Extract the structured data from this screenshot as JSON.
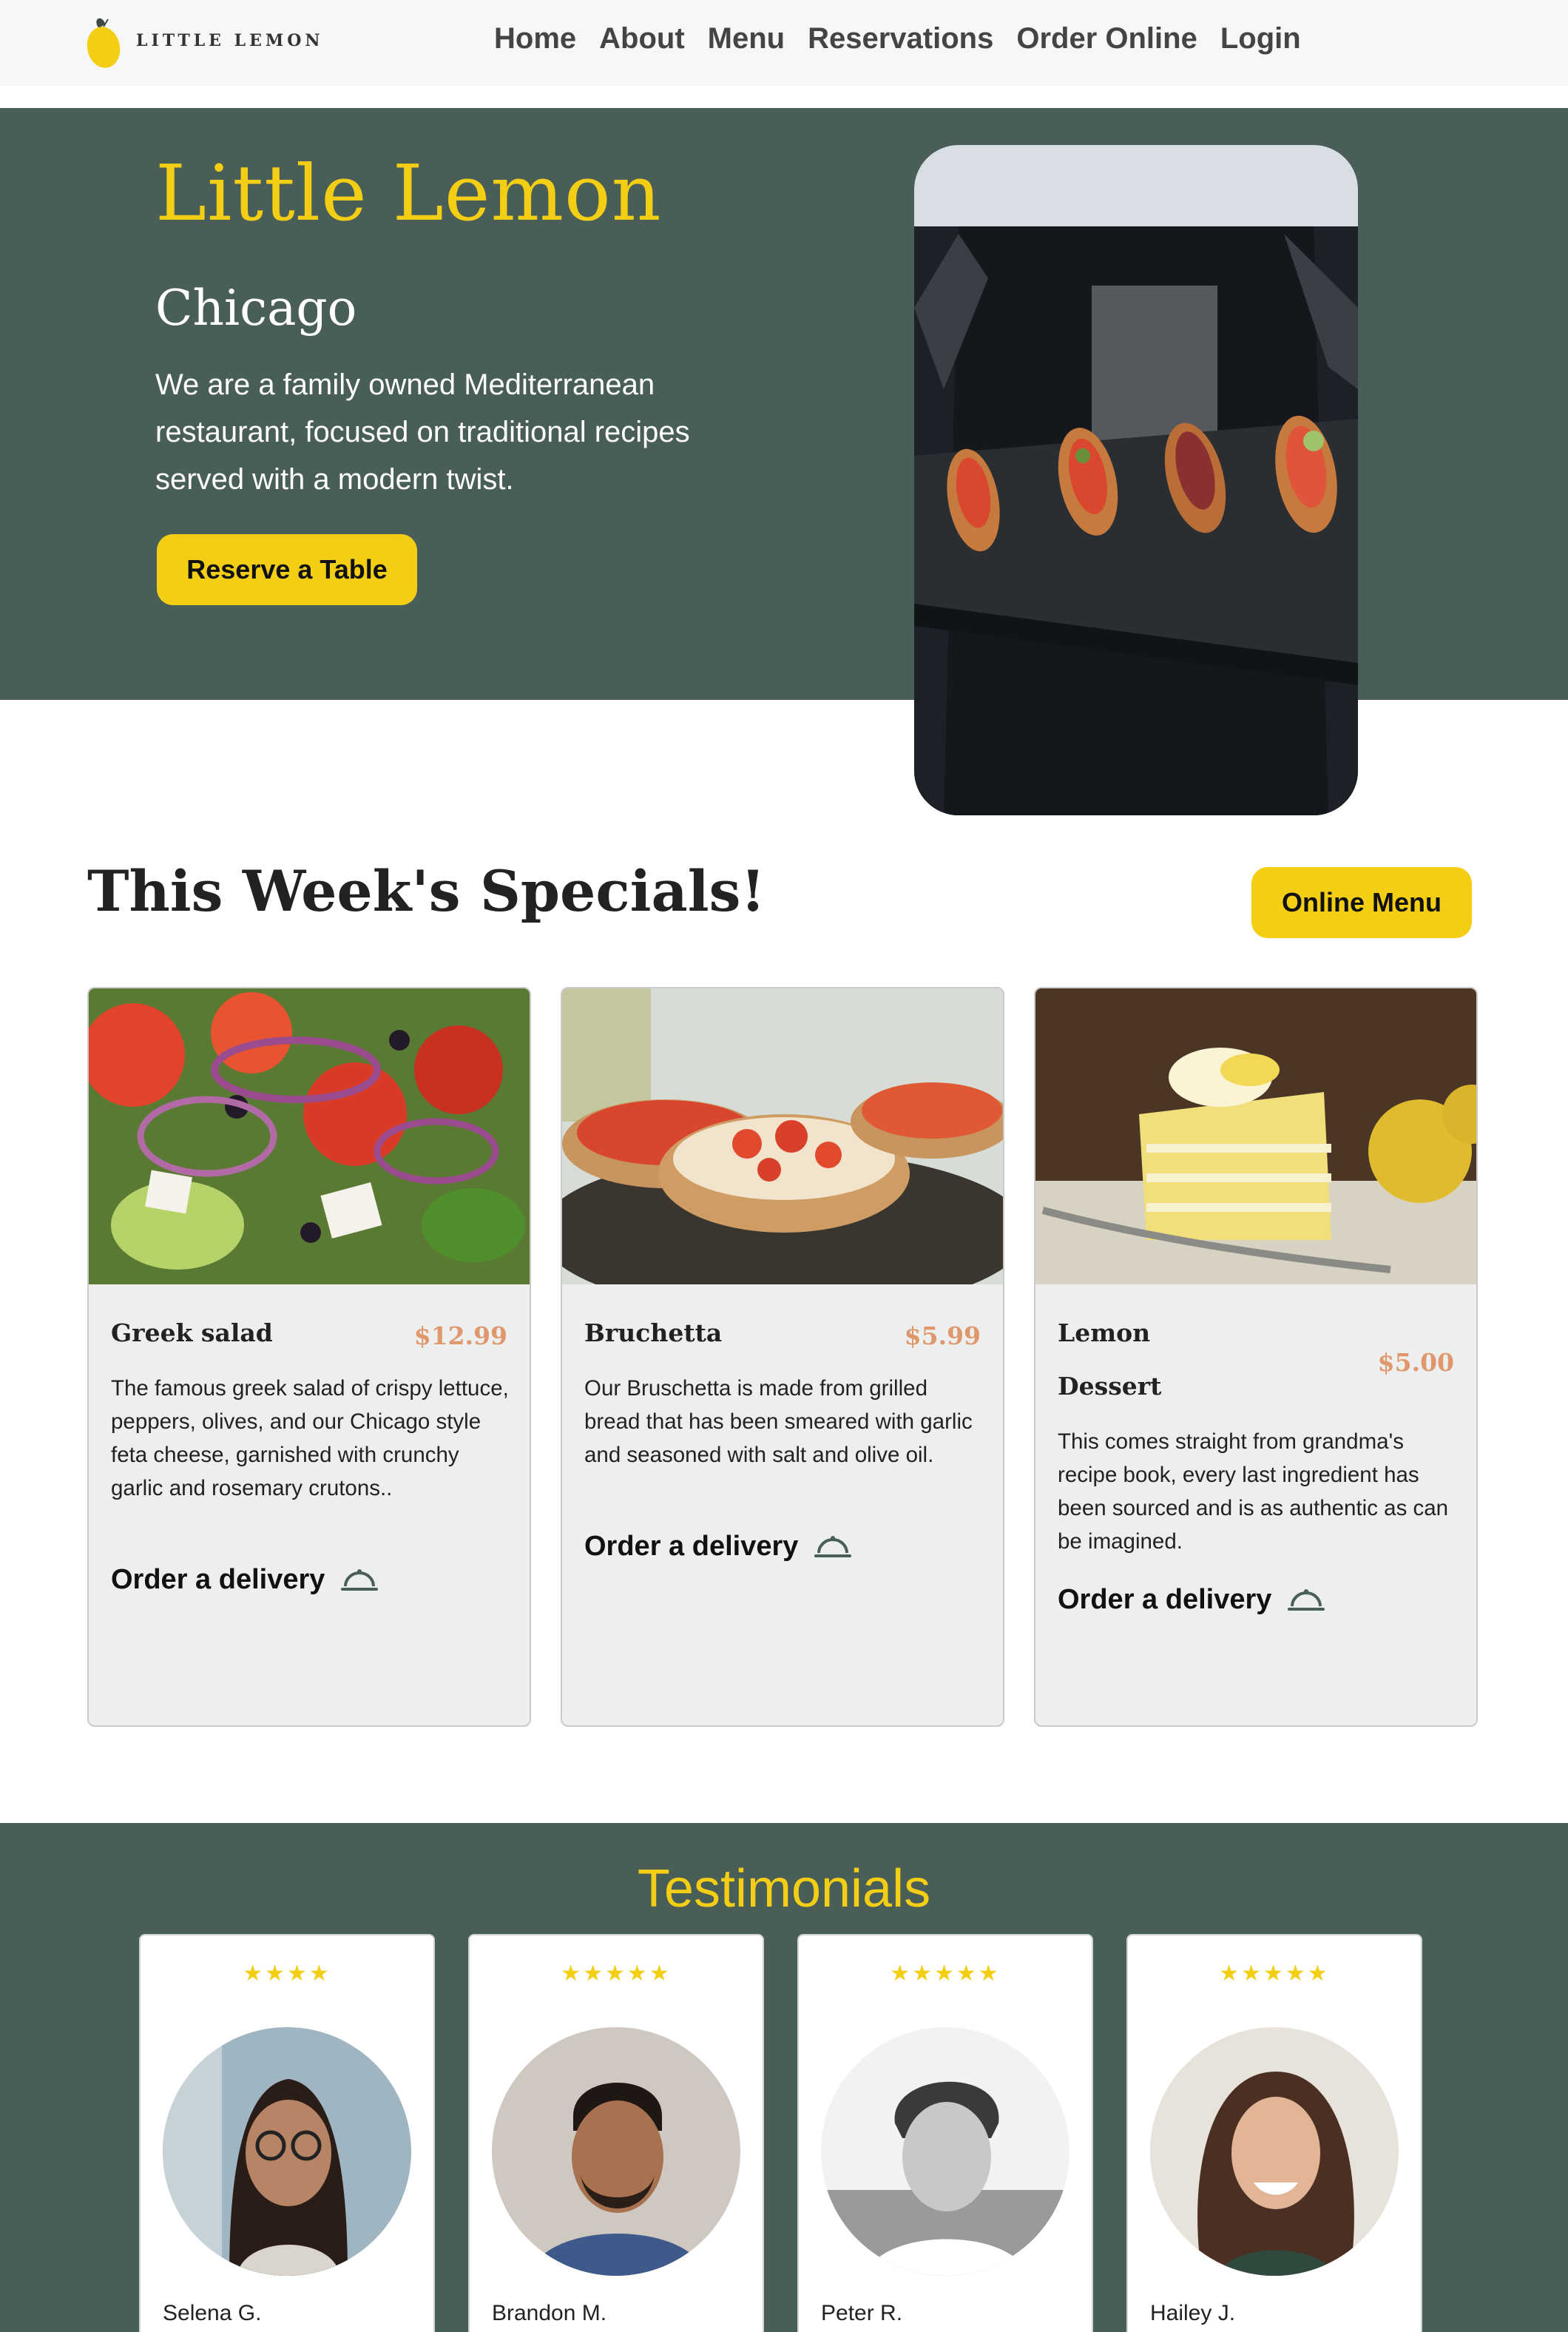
{
  "brand": {
    "logo_text": "LITTLE LEMON"
  },
  "nav": {
    "items": [
      "Home",
      "About",
      "Menu",
      "Reservations",
      "Order Online",
      "Login"
    ]
  },
  "hero": {
    "title": "Little Lemon",
    "subtitle": "Chicago",
    "description": "We are a family owned Mediterranean restaurant, focused on traditional recipes served with a modern twist.",
    "button": "Reserve a Table"
  },
  "specials": {
    "title": "This Week's Specials!",
    "button": "Online Menu",
    "items": [
      {
        "name": "Greek salad",
        "price": "$12.99",
        "description": "The famous greek salad of crispy lettuce, peppers, olives, and our Chicago style feta cheese, garnished with crunchy garlic and rosemary crutons..",
        "order": "Order a delivery"
      },
      {
        "name": "Bruchetta",
        "price": "$5.99",
        "description": "Our Bruschetta is made from grilled bread that has been smeared with garlic and seasoned with salt and olive oil.",
        "order": "Order a delivery"
      },
      {
        "name_line1": "Lemon",
        "name_line2": "Dessert",
        "price": "$5.00",
        "description": "This comes straight from grandma's recipe book, every last ingredient has been sourced and is as authentic as can be imagined.",
        "order": "Order a delivery"
      }
    ]
  },
  "testimonials": {
    "title": "Testimonials",
    "items": [
      {
        "stars": "★★★★",
        "name": "Selena G."
      },
      {
        "stars": "★★★★★",
        "name": "Brandon M."
      },
      {
        "stars": "★★★★★",
        "name": "Peter R."
      },
      {
        "stars": "★★★★★",
        "name": "Hailey J."
      }
    ]
  },
  "colors": {
    "primary_green": "#495e57",
    "primary_yellow": "#f4ce14",
    "price": "#e0976b",
    "card_bg": "#edeeee"
  }
}
